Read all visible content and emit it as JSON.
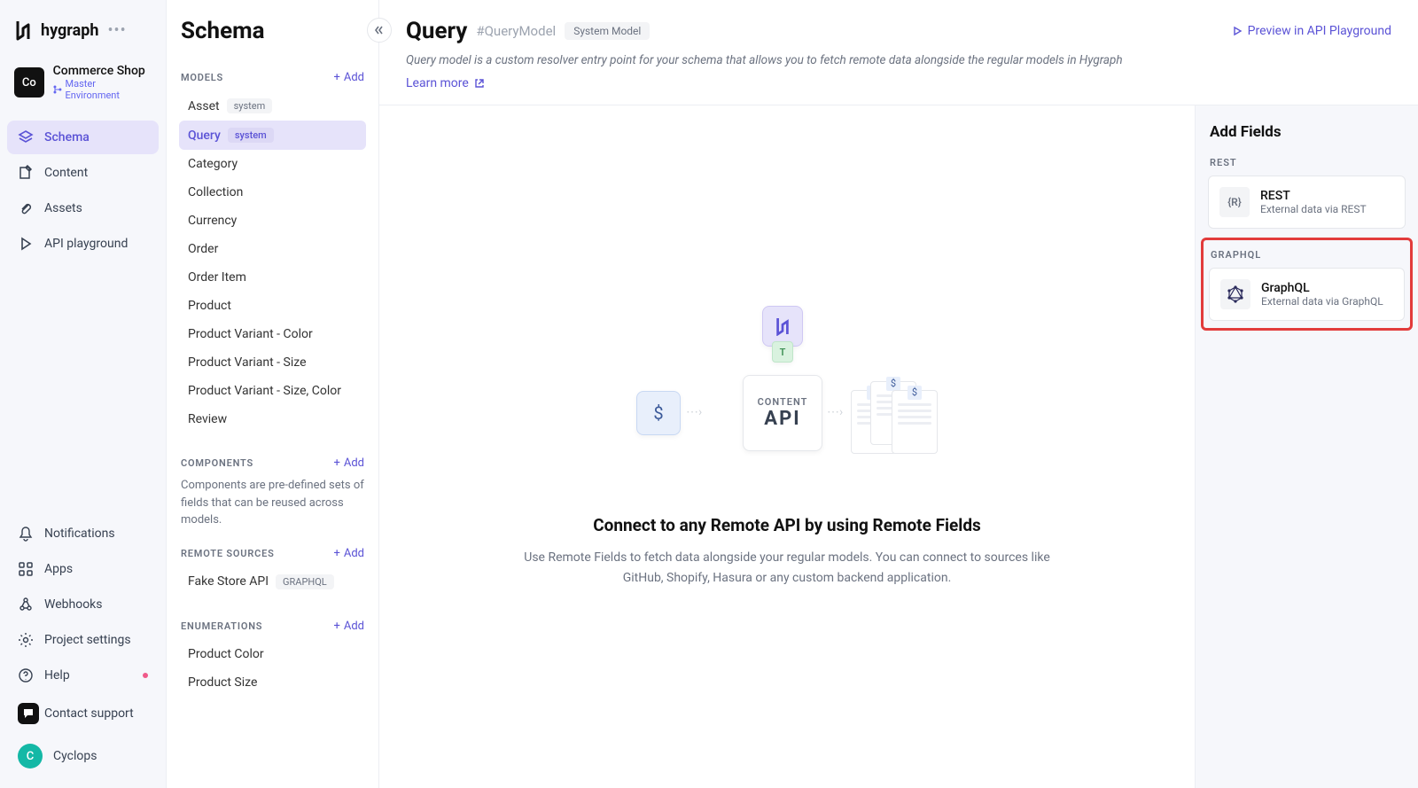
{
  "brand": "hygraph",
  "project": {
    "badge": "Co",
    "name": "Commerce Shop",
    "env": "Master Environment"
  },
  "nav": {
    "main": [
      {
        "label": "Schema",
        "icon": "layers-icon",
        "active": true
      },
      {
        "label": "Content",
        "icon": "edit-icon"
      },
      {
        "label": "Assets",
        "icon": "attachment-icon"
      },
      {
        "label": "API playground",
        "icon": "play-icon"
      }
    ],
    "bottom": [
      {
        "label": "Notifications",
        "icon": "bell-icon"
      },
      {
        "label": "Apps",
        "icon": "grid-icon"
      },
      {
        "label": "Webhooks",
        "icon": "webhook-icon"
      },
      {
        "label": "Project settings",
        "icon": "gear-icon"
      },
      {
        "label": "Help",
        "icon": "help-icon",
        "dot": true
      },
      {
        "label": "Contact support",
        "icon": "chat-icon",
        "badge": true
      }
    ],
    "user": {
      "initial": "C",
      "name": "Cyclops"
    }
  },
  "schema_panel": {
    "title": "Schema",
    "models_header": "MODELS",
    "add": "Add",
    "models": [
      {
        "name": "Asset",
        "system": true
      },
      {
        "name": "Query",
        "system": true,
        "active": true
      },
      {
        "name": "Category"
      },
      {
        "name": "Collection"
      },
      {
        "name": "Currency"
      },
      {
        "name": "Order"
      },
      {
        "name": "Order Item"
      },
      {
        "name": "Product"
      },
      {
        "name": "Product Variant - Color"
      },
      {
        "name": "Product Variant - Size"
      },
      {
        "name": "Product Variant - Size, Color"
      },
      {
        "name": "Review"
      }
    ],
    "components_header": "COMPONENTS",
    "components_desc": "Components are pre-defined sets of fields that can be reused across models.",
    "remote_header": "REMOTE SOURCES",
    "remote_sources": [
      {
        "name": "Fake Store API",
        "tag": "GRAPHQL"
      }
    ],
    "enum_header": "ENUMERATIONS",
    "enums": [
      "Product Color",
      "Product Size"
    ],
    "system_tag": "system"
  },
  "main": {
    "title": "Query",
    "api_id": "#QueryModel",
    "system_model_tag": "System Model",
    "preview": "Preview in API Playground",
    "subtitle": "Query model is a custom resolver entry point for your schema that allows you to fetch remote data alongside the regular models in Hygraph",
    "learn_more": "Learn more",
    "diagram_api_label": "CONTENT",
    "diagram_api_big": "API",
    "empty_title": "Connect to any Remote API by using Remote Fields",
    "empty_desc": "Use Remote Fields to fetch data alongside your regular models. You can connect to sources like GitHub, Shopify, Hasura or any custom backend application."
  },
  "fields": {
    "title": "Add Fields",
    "rest_header": "REST",
    "rest": {
      "name": "REST",
      "desc": "External data via REST",
      "icon_text": "{R}"
    },
    "graphql_header": "GRAPHQL",
    "graphql": {
      "name": "GraphQL",
      "desc": "External data via GraphQL"
    }
  }
}
